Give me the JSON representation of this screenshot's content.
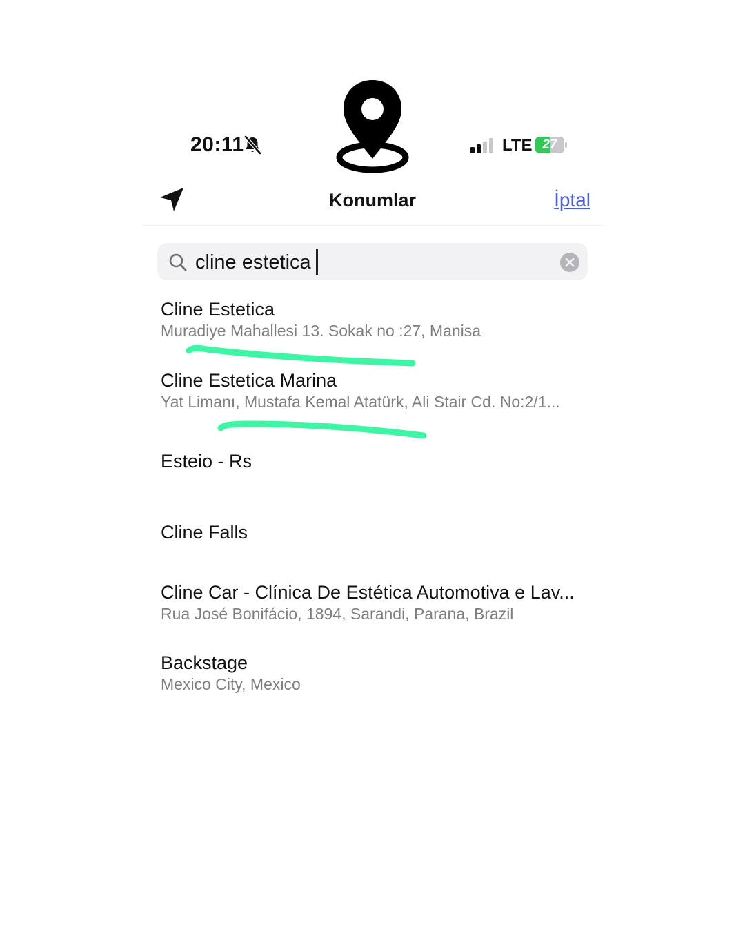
{
  "status_bar": {
    "time": "20:11",
    "network": "LTE",
    "battery_percent": "27"
  },
  "nav": {
    "title": "Konumlar",
    "cancel_label": "İptal"
  },
  "search": {
    "value": "cline estetica",
    "placeholder": ""
  },
  "results": [
    {
      "title": "Cline Estetica",
      "subtitle": "Muradiye Mahallesi 13. Sokak no :27, Manisa"
    },
    {
      "title": "Cline Estetica Marina",
      "subtitle": "Yat Limanı, Mustafa Kemal Atatürk, Ali Stair Cd. No:2/1..."
    },
    {
      "title": "Esteio - Rs",
      "subtitle": ""
    },
    {
      "title": "Cline Falls",
      "subtitle": ""
    },
    {
      "title": "Cline Car - Clínica De Estética Automotiva e Lav...",
      "subtitle": "Rua José Bonifácio, 1894, Sarandi, Parana, Brazil"
    },
    {
      "title": "Backstage",
      "subtitle": "Mexico City, Mexico"
    }
  ],
  "colors": {
    "link": "#4a5fd4",
    "highlight": "#3df5a4",
    "battery": "#34c759",
    "secondary_text": "#7e7e82"
  },
  "icons": {
    "logo": "location-pin-icon",
    "nav_left": "location-arrow-icon",
    "search": "search-icon",
    "clear": "clear-icon",
    "silent": "bell-off-icon"
  }
}
